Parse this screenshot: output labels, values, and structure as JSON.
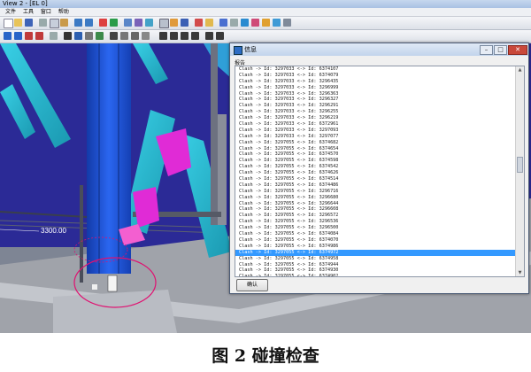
{
  "app": {
    "window_title": "View 2 - [EL 0]"
  },
  "menu": [
    "文件",
    "工具",
    "窗口",
    "帮助"
  ],
  "view": {
    "dimension_label": "3300.00"
  },
  "dialog": {
    "title": "信息",
    "label": "报告",
    "ok_label": "确认",
    "rows": [
      "Clash -> Id: 3297033 <-> Id: 6374107",
      "Clash -> Id: 3297033 <-> Id: 6374079",
      "Clash -> Id: 3297033 <-> Id: 3296435",
      "Clash -> Id: 3297033 <-> Id: 3296999",
      "Clash -> Id: 3297033 <-> Id: 3296363",
      "Clash -> Id: 3297033 <-> Id: 3296327",
      "Clash -> Id: 3297033 <-> Id: 3296291",
      "Clash -> Id: 3297033 <-> Id: 3296255",
      "Clash -> Id: 3297033 <-> Id: 3296219",
      "Clash -> Id: 3297033 <-> Id: 6372961",
      "Clash -> Id: 3297033 <-> Id: 3297093",
      "Clash -> Id: 3297033 <-> Id: 3297077",
      "Clash -> Id: 3297055 <-> Id: 6374682",
      "Clash -> Id: 3297055 <-> Id: 6374654",
      "Clash -> Id: 3297055 <-> Id: 6374570",
      "Clash -> Id: 3297055 <-> Id: 6374598",
      "Clash -> Id: 3297055 <-> Id: 6374542",
      "Clash -> Id: 3297055 <-> Id: 6374626",
      "Clash -> Id: 3297055 <-> Id: 6374514",
      "Clash -> Id: 3297055 <-> Id: 6374486",
      "Clash -> Id: 3297055 <-> Id: 3296716",
      "Clash -> Id: 3297055 <-> Id: 3296680",
      "Clash -> Id: 3297055 <-> Id: 3296644",
      "Clash -> Id: 3297055 <-> Id: 3296608",
      "Clash -> Id: 3297055 <-> Id: 3296572",
      "Clash -> Id: 3297055 <-> Id: 3296536",
      "Clash -> Id: 3297055 <-> Id: 3296500",
      "Clash -> Id: 3297055 <-> Id: 6374084",
      "Clash -> Id: 3297055 <-> Id: 6374070",
      "Clash -> Id: 3297055 <-> Id: 6374986",
      "Clash -> Id: 3297055 <-> Id: 6374972",
      "Clash -> Id: 3297055 <-> Id: 6374958",
      "Clash -> Id: 3297055 <-> Id: 6374944",
      "Clash -> Id: 3297055 <-> Id: 6374930",
      "Clash -> Id: 3297055 <-> Id: 6374902",
      "Clash -> Id: 3297055 <-> Id: 3296997"
    ],
    "selected_index": 30
  },
  "caption": "图 2  碰撞检查",
  "colors": {
    "beam": "#25b8d0",
    "column": "#1e56d8",
    "background": "#2b2a96",
    "clash": "#e02bd6",
    "selection": "#3399ff"
  }
}
